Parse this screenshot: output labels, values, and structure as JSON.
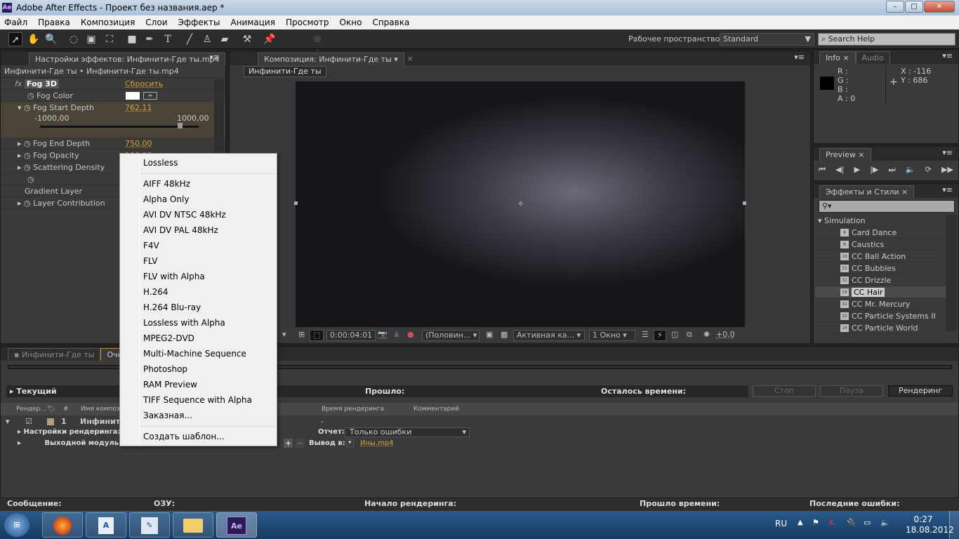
{
  "titlebar": {
    "title": "Adobe After Effects - Проект без названия.aep *",
    "app_icon": "Ae"
  },
  "menubar": {
    "items": [
      "Файл",
      "Правка",
      "Композиция",
      "Слои",
      "Эффекты",
      "Анимация",
      "Просмотр",
      "Окно",
      "Справка"
    ]
  },
  "toolbar": {
    "workspace_label": "Рабочее пространство:",
    "workspace_value": "Standard",
    "search_placeholder": "Search Help"
  },
  "effects_panel": {
    "tab": "Настройки эффектов: Инфинити-Где ты.mp4",
    "breadcrumb": "Инфинити-Где ты • Инфинити-Где ты.mp4",
    "effect_name": "Fog 3D",
    "reset": "Сбросить",
    "props": [
      {
        "name": "Fog Color",
        "value": ""
      },
      {
        "name": "Fog Start Depth",
        "value": "762,11"
      },
      {
        "name": "Fog End Depth",
        "value": "750,00"
      },
      {
        "name": "Fog Opacity",
        "value": "100,00"
      },
      {
        "name": "Scattering Density",
        "value": ""
      },
      {
        "name": "",
        "value": ""
      },
      {
        "name": "Gradient Layer",
        "value": ""
      },
      {
        "name": "Layer Contribution",
        "value": ""
      }
    ],
    "slider_min": "-1000,00",
    "slider_max": "1000,00",
    "slider_value_fraction": 0.881
  },
  "composition_panel": {
    "tab": "Композиция: Инфинити-Где ты",
    "flowchart_tab": "Инфинити-Где ты",
    "timecode": "0:00:04:01",
    "resolution": "(Половин...",
    "camera": "Активная ка...",
    "views": "1 Окно",
    "exposure": "+0,0"
  },
  "info_panel": {
    "tabs": [
      "Info",
      "Audio"
    ],
    "r": "R :",
    "g": "G :",
    "b": "B :",
    "a": "A : 0",
    "x": "X : -116",
    "y": "Y : 686"
  },
  "preview_panel": {
    "tab": "Preview"
  },
  "effects_styles": {
    "tab": "Эффекты и Стили",
    "category": "Simulation",
    "items": [
      {
        "name": "Card Dance",
        "bits": "8"
      },
      {
        "name": "Caustics",
        "bits": "8"
      },
      {
        "name": "CC Ball Action",
        "bits": "16"
      },
      {
        "name": "CC Bubbles",
        "bits": "32"
      },
      {
        "name": "CC Drizzle",
        "bits": "32"
      },
      {
        "name": "CC Hair",
        "bits": "16",
        "selected": true
      },
      {
        "name": "CC Mr. Mercury",
        "bits": "32"
      },
      {
        "name": "CC Particle Systems II",
        "bits": "32"
      },
      {
        "name": "CC Particle World",
        "bits": "16"
      }
    ]
  },
  "render_queue": {
    "tabs": [
      "Инфинити-Где ты",
      "Очередь рендеринга"
    ],
    "current": "Текущий",
    "elapsed": "Прошло:",
    "remaining": "Осталось времени:",
    "buttons": {
      "stop": "Стоп",
      "pause": "Пауза",
      "render": "Рендеринг"
    },
    "columns": [
      "Рендер...",
      "#",
      "Имя композиции",
      "Время рендеринга",
      "Комментарий"
    ],
    "item": {
      "num": "1",
      "name": "Инфинити-Где ты",
      "time": "-"
    },
    "render_settings": "Настройки рендеринга:",
    "output_module": "Выходной модуль:",
    "log_label": "Отчет:",
    "log_value": "Только ошибки",
    "output_to": "Вывод в:",
    "output_file": "Ины.mp4",
    "status": {
      "message": "Сообщение:",
      "ram": "ОЗУ:",
      "started": "Начало рендеринга:",
      "total": "Прошло времени:",
      "errors": "Последние ошибки:"
    }
  },
  "popup_menu": {
    "items": [
      "Lossless",
      "AIFF 48kHz",
      "Alpha Only",
      "AVI DV NTSC 48kHz",
      "AVI DV PAL 48kHz",
      "F4V",
      "FLV",
      "FLV with Alpha",
      "H.264",
      "H.264 Blu-ray",
      "Lossless with Alpha",
      "MPEG2-DVD",
      "Multi-Machine Sequence",
      "Photoshop",
      "RAM Preview",
      "TIFF Sequence with Alpha",
      "Заказная...",
      "Создать шаблон..."
    ]
  },
  "taskbar": {
    "lang": "RU",
    "time": "0:27",
    "date": "18.08.2012",
    "apps": [
      "Windows",
      "Firefox",
      "Word",
      "Paint",
      "Explorer",
      "Ae"
    ]
  }
}
